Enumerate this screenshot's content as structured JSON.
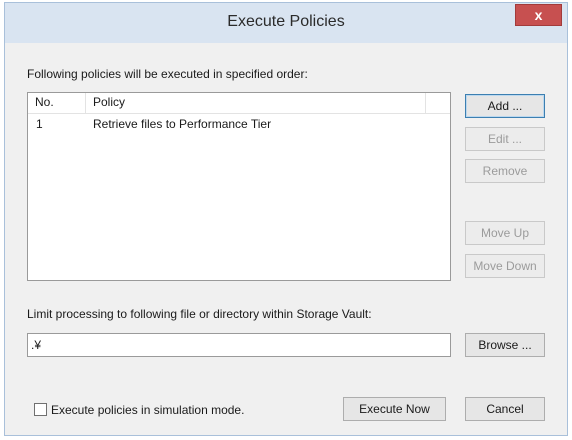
{
  "window": {
    "title": "Execute Policies",
    "close_glyph": "x"
  },
  "policies": {
    "caption": "Following policies will be executed in specified order:",
    "columns": [
      "No.",
      "Policy"
    ],
    "rows": [
      {
        "no": "1",
        "policy": "Retrieve files to Performance Tier"
      }
    ]
  },
  "side_buttons": {
    "add": "Add ...",
    "edit": "Edit ...",
    "remove": "Remove",
    "move_up": "Move Up",
    "move_down": "Move Down"
  },
  "limit": {
    "caption": "Limit processing to following file or directory within Storage Vault:",
    "value": ".¥",
    "browse": "Browse ..."
  },
  "footer": {
    "simulation_label": "Execute policies in simulation mode.",
    "simulation_checked": false,
    "execute_now": "Execute Now",
    "cancel": "Cancel"
  },
  "colors": {
    "close_button": "#c75050",
    "titlebar": "#d9e4f1",
    "window_bg": "#f0f0f0"
  }
}
